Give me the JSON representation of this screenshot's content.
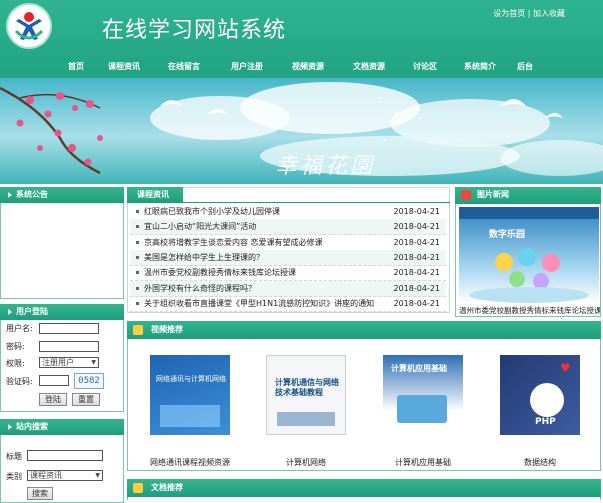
{
  "header": {
    "title": "在线学习网站系统",
    "set_home": "设为首页",
    "separator": "|",
    "add_favorite": "加入收藏"
  },
  "nav": [
    "首页",
    "课程资讯",
    "在线留言",
    "用户注册",
    "视频资源",
    "文档资源",
    "讨论区",
    "系统简介",
    "后台"
  ],
  "banner": {
    "text": "幸福花園"
  },
  "announcement": {
    "title": "系统公告"
  },
  "login": {
    "title": "用户登陆",
    "username_label": "用户名:",
    "password_label": "密码:",
    "role_label": "权限:",
    "role_value": "注册用户",
    "captcha_label": "验证码:",
    "captcha_code": "0582",
    "login_button": "登陆",
    "reset_button": "重置"
  },
  "search": {
    "title": "站内搜索",
    "title_label": "标题",
    "category_label": "类别",
    "category_value": "课程资讯",
    "search_button": "搜索"
  },
  "news": {
    "title": "课程资讯",
    "items": [
      {
        "title": "红眼病已致我市个别小学及幼儿园停课",
        "date": "2018-04-21"
      },
      {
        "title": "宜山二小启动“阳光大课间”活动",
        "date": "2018-04-21"
      },
      {
        "title": "京高校将增教学生谈恋爱内容 恋爱课有望成必修课",
        "date": "2018-04-21"
      },
      {
        "title": "美国是怎样给中学生上生理课的？",
        "date": "2018-04-21"
      },
      {
        "title": "温州市委党校副教授秀倩标来钱库论坛授课",
        "date": "2018-04-21"
      },
      {
        "title": "外国学校有什么奇怪的课程吗？",
        "date": "2018-04-21"
      },
      {
        "title": "关于组织收看市直播课堂《甲型H1N1流感防控知识》讲座的通知",
        "date": "2018-04-21"
      }
    ]
  },
  "photo_news": {
    "title": "图片新闻",
    "caption": "温州市委党校副教授秀倩标来钱库论坛授课",
    "inner_title": "数字乐园"
  },
  "video": {
    "title": "视频推荐",
    "items": [
      {
        "label": "网络通讯课程视频资源",
        "cover_text": "网络通讯与计算机网络"
      },
      {
        "label": "计算机网络",
        "cover_text": "计算机通信与网络技术基础教程"
      },
      {
        "label": "计算机应用基础",
        "cover_text": "计算机应用基础"
      },
      {
        "label": "数据结构",
        "cover_text": "PHP"
      }
    ]
  },
  "docs": {
    "title": "文档推荐"
  },
  "colors": {
    "primary": "#21a381",
    "accent": "#34b58f",
    "border": "#79c7b1"
  }
}
